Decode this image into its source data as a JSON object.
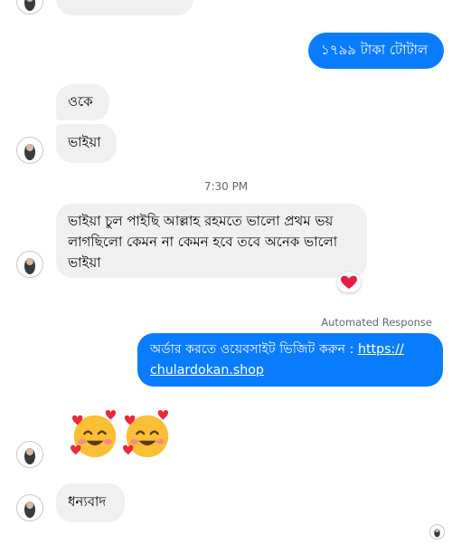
{
  "conversation": {
    "outgoing_total": "১৭৯৯ টাকা টোটাল",
    "incoming_ok": "ওকে",
    "incoming_bhaiya": "ভাইয়া",
    "timestamp": "7:30 PM",
    "incoming_review": "ভাইয়া চুল পাইছি আল্লাহ রহমতে ভালো প্রথম ভয় লাগছিলো কেমন না কেমন হবে তবে অনেক ভালো ভাইয়া",
    "reaction_icon": "red-heart-icon",
    "automated_label": "Automated Response",
    "auto_text": "অর্ডার করতে ওয়েবসাইট ভিজিট করুন : ",
    "auto_link_part1": "https://",
    "auto_link_part2": "chulardokan.shop",
    "emoji_icon": "smiling-face-with-hearts-icon",
    "incoming_thanks": "ধন্যবাদ"
  },
  "colors": {
    "outgoing_bubble": "#0a7cff",
    "incoming_bubble": "#f0f0f0",
    "reaction_heart": "#e41e3f"
  }
}
